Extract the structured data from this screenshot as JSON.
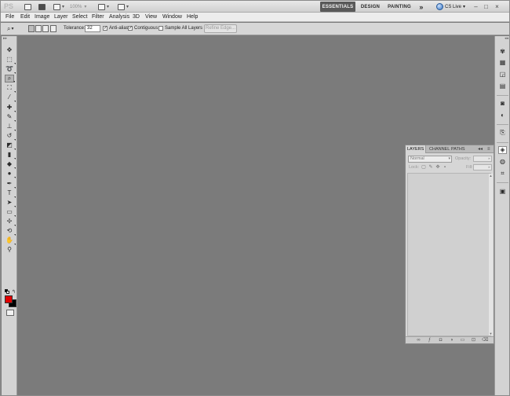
{
  "app": {
    "logo_text": "PS",
    "zoom_label": "100%",
    "workspaces": [
      "ESSENTIALS",
      "DESIGN",
      "PAINTING"
    ],
    "active_workspace": "ESSENTIALS",
    "more_symbol": "»",
    "cs_live_label": "CS Live",
    "window_controls": [
      "–",
      "□",
      "×"
    ]
  },
  "menu": {
    "items": [
      "File",
      "Edit",
      "Image",
      "Layer",
      "Select",
      "Filter",
      "Analysis",
      "3D",
      "View",
      "Window",
      "Help"
    ]
  },
  "options_bar": {
    "tolerance_label": "Tolerance:",
    "tolerance_value": "32",
    "anti_alias_label": "Anti-alias",
    "anti_alias_checked": true,
    "contiguous_label": "Contiguous",
    "contiguous_checked": true,
    "sample_all_layers_label": "Sample All Layers",
    "sample_all_layers_checked": false,
    "refine_edge_label": "Refine Edge..."
  },
  "tools": {
    "active_tool": "quick-selection-tool",
    "foreground_color": "#e10000",
    "background_color": "#000000"
  },
  "layers_panel": {
    "tabs": [
      "LAYERS",
      "CHANNEL",
      "PATHS"
    ],
    "active_tab": "LAYERS",
    "blend_mode": "Normal",
    "opacity_label": "Opacity:",
    "lock_label": "Lock:",
    "fill_label": "Fill:"
  },
  "colors": {
    "canvas_bg": "#7b7b7b",
    "panel_bg": "#d6d6d6",
    "active_workspace_bg": "#595959"
  }
}
